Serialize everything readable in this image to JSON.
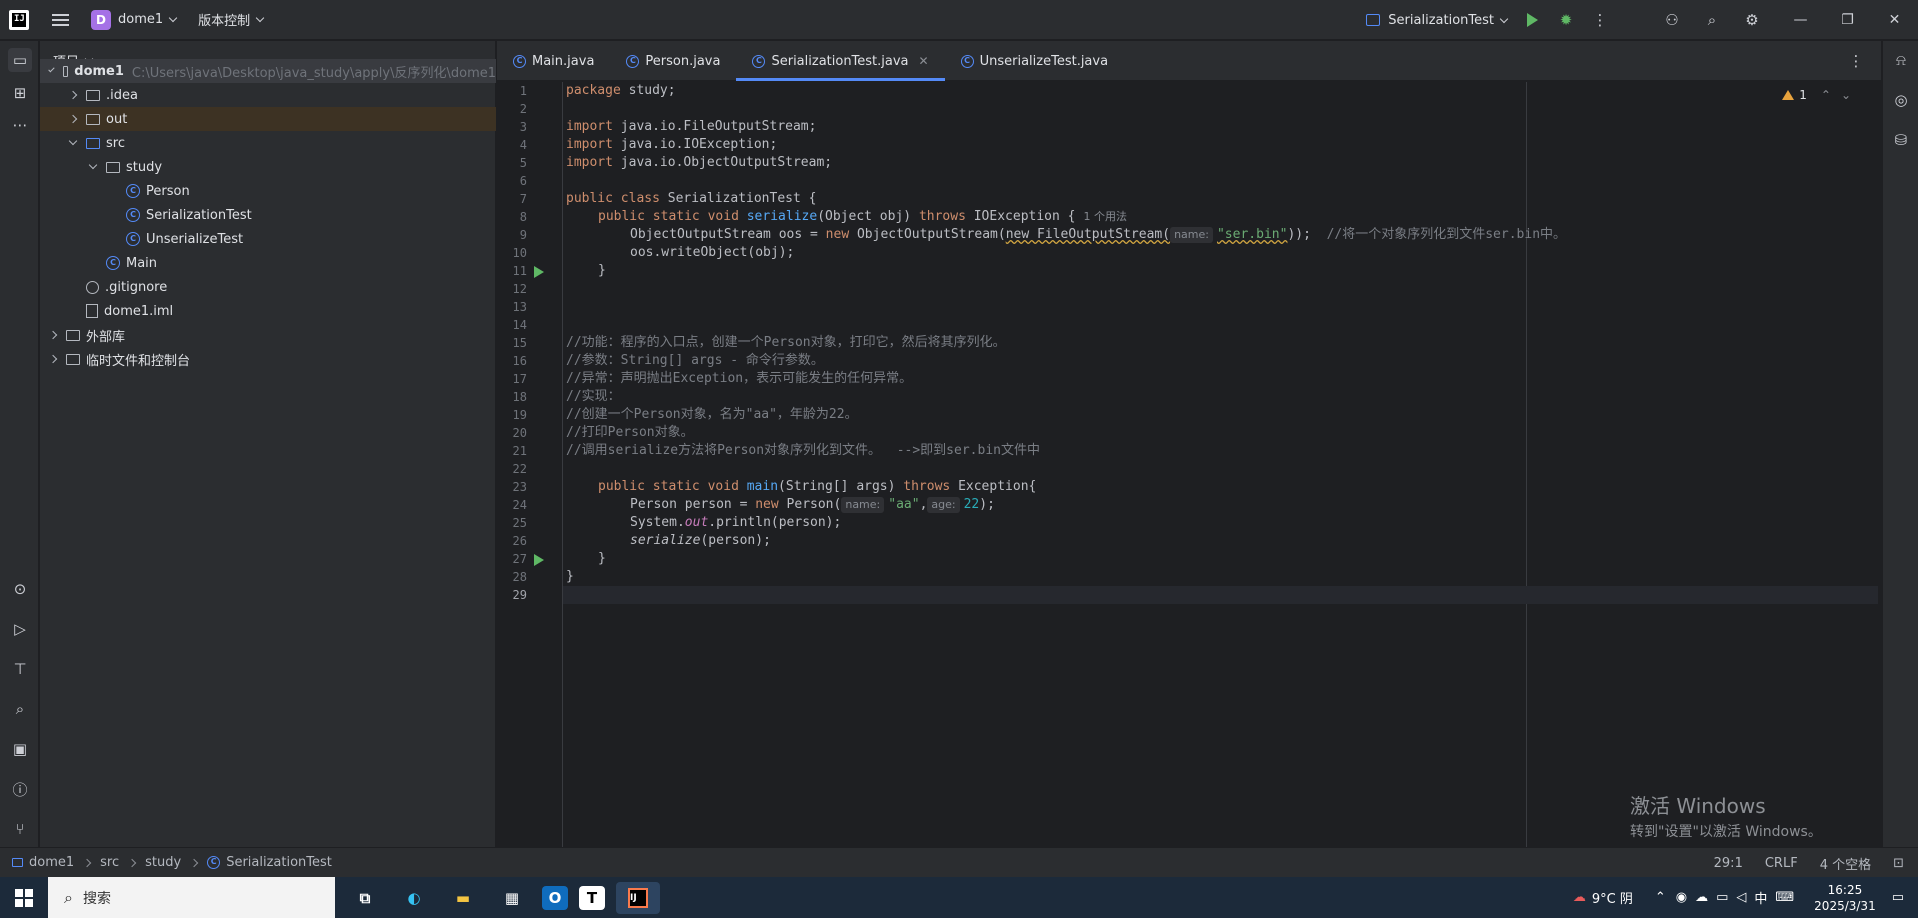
{
  "titlebar": {
    "project_initial": "D",
    "project_name": "dome1",
    "vcs_label": "版本控制",
    "run_config": "SerializationTest"
  },
  "project_panel": {
    "title": "项目",
    "tree": [
      {
        "label": "dome1",
        "path": "C:\\Users\\java\\Desktop\\java_study\\apply\\反序列化\\dome1",
        "icon": "folder-icon",
        "level": 0,
        "expanded": true
      },
      {
        "label": ".idea",
        "icon": "folder-icon",
        "level": 1,
        "expanded": false
      },
      {
        "label": "out",
        "icon": "folder-icon",
        "level": 1,
        "expanded": false
      },
      {
        "label": "src",
        "icon": "source-folder-icon",
        "level": 1,
        "expanded": true
      },
      {
        "label": "study",
        "icon": "package-icon",
        "level": 2,
        "expanded": true
      },
      {
        "label": "Person",
        "icon": "class-icon",
        "level": 3
      },
      {
        "label": "SerializationTest",
        "icon": "class-icon",
        "level": 3
      },
      {
        "label": "UnserializeTest",
        "icon": "class-icon",
        "level": 3
      },
      {
        "label": "Main",
        "icon": "class-icon",
        "level": 2
      },
      {
        "label": ".gitignore",
        "icon": "gitignore-icon",
        "level": 1
      },
      {
        "label": "dome1.iml",
        "icon": "file-icon",
        "level": 1
      },
      {
        "label": "外部库",
        "icon": "library-icon",
        "level": 0,
        "expanded": false
      },
      {
        "label": "临时文件和控制台",
        "icon": "scratches-icon",
        "level": 0,
        "expanded": false
      }
    ]
  },
  "tabs": [
    {
      "label": "Main.java"
    },
    {
      "label": "Person.java"
    },
    {
      "label": "SerializationTest.java",
      "active": true
    },
    {
      "label": "UnserializeTest.java"
    }
  ],
  "editor": {
    "warning_count": "1",
    "line_numbers": [
      "1",
      "2",
      "3",
      "4",
      "5",
      "6",
      "7",
      "8",
      "9",
      "10",
      "11",
      "12",
      "13",
      "14",
      "15",
      "16",
      "17",
      "18",
      "19",
      "20",
      "21",
      "22",
      "23",
      "24",
      "25",
      "26",
      "27",
      "28",
      "29"
    ],
    "tokens": {
      "l1a": "package",
      "l1b": " study;",
      "imp": "import",
      "l3": " java.io.FileOutputStream;",
      "l4": " java.io.IOException;",
      "l5": " java.io.ObjectOutputStream;",
      "public": "public",
      "class": "class",
      "static": "static",
      "void": "void",
      "new": "new",
      "throws": "throws",
      "l7c": " SerializationTest {",
      "l8fn": "serialize",
      "l8a": "(Object obj) ",
      "l8b": " IOException {",
      "l8usage": "1 个用法",
      "l9a": "ObjectOutputStream oos = ",
      "l9b": " ObjectOutputStream(",
      "l9c": "new FileOutputStream(",
      "l9hint": "name:",
      "l9str": "\"ser.bin\"",
      "l9d": "));  ",
      "l9cm": "//将一个对象序列化到文件ser.bin中。",
      "l10": "oos.writeObject(obj);",
      "l11": "}",
      "l15": "//功能：程序的入口点，创建一个Person对象，打印它，然后将其序列化。",
      "l16": "//参数：String[] args - 命令行参数。",
      "l17": "//异常：声明抛出Exception，表示可能发生的任何异常。",
      "l18": "//实现：",
      "l19": "//创建一个Person对象，名为\"aa\"，年龄为22。",
      "l20": "//打印Person对象。",
      "l21": "//调用serialize方法将Person对象序列化到文件。  -->即到ser.bin文件中",
      "l23fn": "main",
      "l23a": "(String[] args) ",
      "l23b": " Exception{",
      "l24a": "Person person = ",
      "l24b": " Person(",
      "l24hint1": "name:",
      "l24str": "\"aa\"",
      "l24comma": ",",
      "l24hint2": "age:",
      "l24num": "22",
      "l24c": ");",
      "l25a": "System.",
      "l25out": "out",
      "l25b": ".println(person);",
      "l26fn": "serialize",
      "l26b": "(person);",
      "l27": "}",
      "l28": "}"
    }
  },
  "watermark": {
    "line1": "激活 Windows",
    "line2": "转到\"设置\"以激活 Windows。"
  },
  "statusbar": {
    "breadcrumb": [
      "dome1",
      "src",
      "study",
      "SerializationTest"
    ],
    "position": "29:1",
    "line_sep": "CRLF",
    "indent": "4 个空格"
  },
  "taskbar": {
    "search_placeholder": "搜索",
    "weather": "9°C 阴",
    "ime": "中",
    "time": "16:25",
    "date": "2025/3/31"
  }
}
